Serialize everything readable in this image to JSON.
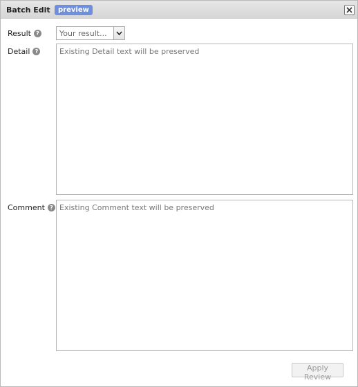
{
  "dialog": {
    "title": "Batch Edit",
    "badge": "preview",
    "close_icon": "close-icon"
  },
  "form": {
    "result": {
      "label": "Result",
      "help_icon": "question-circle-icon",
      "selected": "Your result..."
    },
    "detail": {
      "label": "Detail",
      "help_icon": "question-circle-icon",
      "placeholder": "Existing Detail text will be preserved"
    },
    "comment": {
      "label": "Comment",
      "help_icon": "question-circle-icon",
      "placeholder": "Existing Comment text will be preserved"
    }
  },
  "footer": {
    "apply_label": "Apply Review"
  },
  "colors": {
    "badge": "#6f8fdc",
    "titlebar": "#dddddd"
  }
}
